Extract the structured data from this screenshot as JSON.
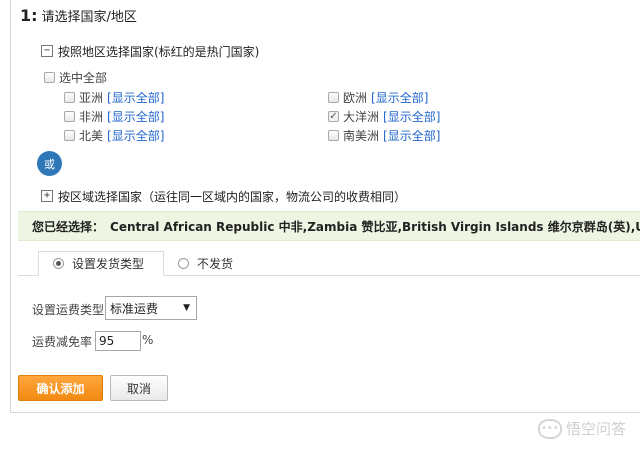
{
  "step": {
    "number": "1:",
    "title": "请选择国家/地区"
  },
  "by_region": {
    "toggle_symbol": "−",
    "label": "按照地区选择国家(标红的是热门国家)",
    "select_all_label": "选中全部",
    "show_all_label": "[显示全部]",
    "regions": [
      {
        "name": "亚洲",
        "checked": false
      },
      {
        "name": "非洲",
        "checked": false
      },
      {
        "name": "北美",
        "checked": false
      },
      {
        "name": "欧洲",
        "checked": false
      },
      {
        "name": "大洋洲",
        "checked": true
      },
      {
        "name": "南美洲",
        "checked": false
      }
    ]
  },
  "or_label": "或",
  "by_zone": {
    "toggle_symbol": "+",
    "label": "按区域选择国家（运往同一区域内的国家，物流公司的收费相同）"
  },
  "selected": {
    "prefix": "您已经选择：",
    "countries": "Central African Republic 中非,Zambia 赞比亚,British Virgin Islands 维尔京群岛(英),Uganda 乌干"
  },
  "tabs": [
    {
      "label": "设置发货类型",
      "selected": true
    },
    {
      "label": "不发货",
      "selected": false
    }
  ],
  "form": {
    "shipping_type_label": "设置运费类型",
    "shipping_type_value": "标准运费",
    "discount_label": "运费减免率",
    "discount_value": "95",
    "discount_unit": "%"
  },
  "buttons": {
    "confirm": "确认添加",
    "cancel": "取消"
  },
  "watermark": {
    "text": "悟空问答"
  },
  "colors": {
    "accent_orange": "#f28a12",
    "link_blue": "#2266cc",
    "or_circle": "#2f78b8",
    "selected_bg": "#eef6e3"
  }
}
